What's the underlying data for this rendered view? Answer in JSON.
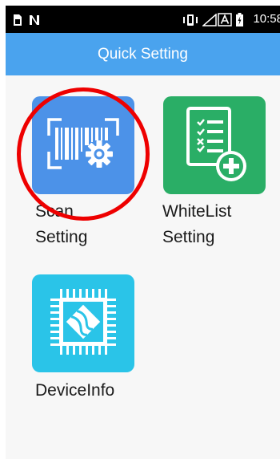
{
  "status_bar": {
    "time": "10:58",
    "icons": [
      "sim-icon",
      "notification-n-icon",
      "vibrate-icon",
      "signal-icon",
      "a-box-icon",
      "battery-icon"
    ]
  },
  "app_bar": {
    "title": "Quick Setting"
  },
  "tiles": [
    {
      "label_line1": "Scan",
      "label_line2": "Setting",
      "icon": "barcode-gear-icon",
      "color": "#4c92e8"
    },
    {
      "label_line1": "WhiteList",
      "label_line2": "Setting",
      "icon": "checklist-add-icon",
      "color": "#2aae66"
    },
    {
      "label_line1": "DeviceInfo",
      "label_line2": "",
      "icon": "chip-icon",
      "color": "#2ac4e8"
    }
  ],
  "colors": {
    "app_bar": "#4aa3ee",
    "highlight": "#ee0000"
  }
}
